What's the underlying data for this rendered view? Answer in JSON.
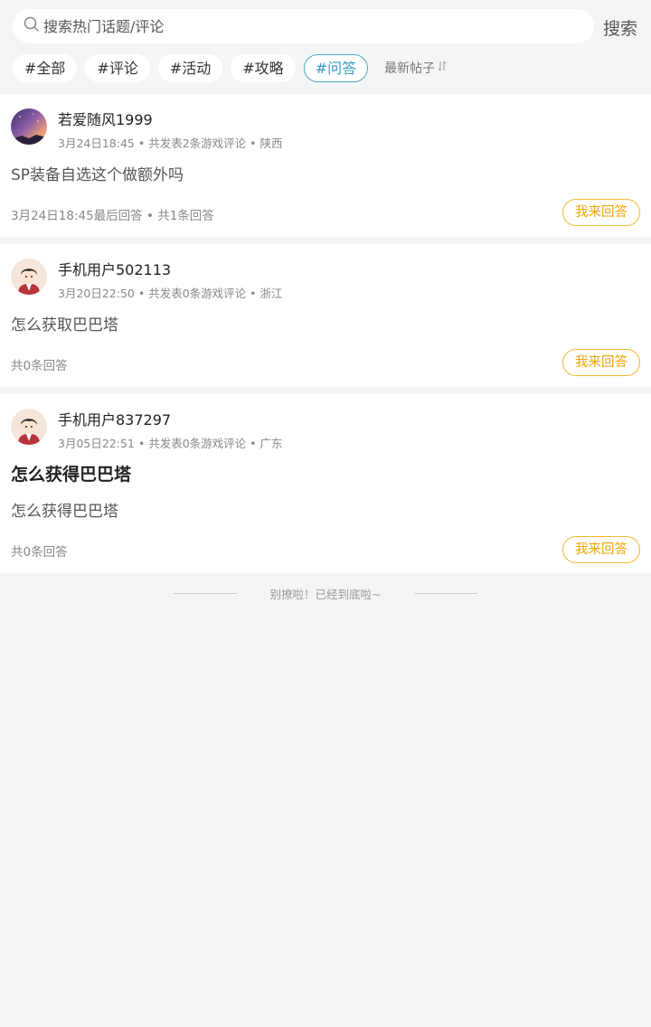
{
  "search": {
    "placeholder": "搜索热门话题/评论",
    "button_label": "搜索"
  },
  "tags": [
    {
      "label": "#全部",
      "active": false
    },
    {
      "label": "#评论",
      "active": false
    },
    {
      "label": "#活动",
      "active": false
    },
    {
      "label": "#攻略",
      "active": false
    },
    {
      "label": "#问答",
      "active": true
    }
  ],
  "sort": {
    "label": "最新帖子"
  },
  "colors": {
    "accent": "#3a9bbf",
    "answer_button": "#f0a500",
    "background": "#f4f5f7"
  },
  "posts": [
    {
      "username": "若爱随风1999",
      "meta": "3月24日18:45 • 共发表2条游戏评论 • 陕西",
      "title": "",
      "body": "SP装备自选这个做额外吗",
      "footer": "3月24日18:45最后回答 • 共1条回答",
      "answer_label": "我来回答",
      "avatar": "galaxy-avatar"
    },
    {
      "username": "手机用户502113",
      "meta": "3月20日22:50 • 共发表0条游戏评论 • 浙江",
      "title": "",
      "body": "怎么获取巴巴塔",
      "footer": "共0条回答",
      "answer_label": "我来回答",
      "avatar": "cartoon-boy-avatar"
    },
    {
      "username": "手机用户837297",
      "meta": "3月05日22:51 • 共发表0条游戏评论 • 广东",
      "title": "怎么获得巴巴塔",
      "body": "怎么获得巴巴塔",
      "footer": "共0条回答",
      "answer_label": "我来回答",
      "avatar": "cartoon-boy-avatar"
    }
  ],
  "end_note": "别撩啦！已经到底啦~"
}
